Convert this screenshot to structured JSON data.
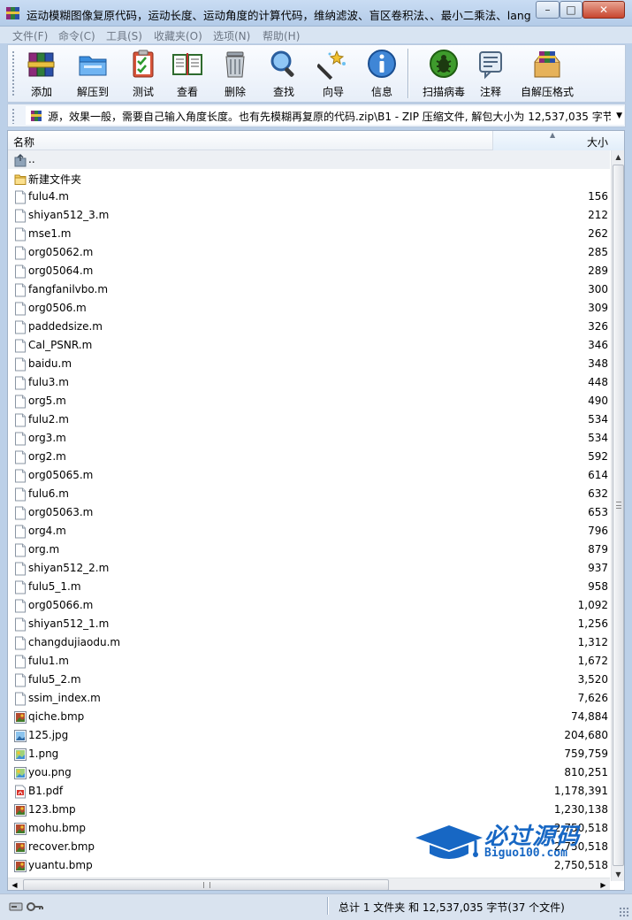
{
  "window": {
    "title": "运动模糊图像复原代码，运动长度、运动角度的计算代码，维纳滤波、盲区卷积法、、最小二乘法、lang...",
    "minimize": "–",
    "maximize": "□",
    "close": "✕"
  },
  "menu": [
    "文件(F)",
    "命令(C)",
    "工具(S)",
    "收藏夹(O)",
    "选项(N)",
    "帮助(H)"
  ],
  "toolbar": {
    "add": "添加",
    "extract": "解压到",
    "test": "测试",
    "view": "查看",
    "delete": "删除",
    "find": "查找",
    "wizard": "向导",
    "info": "信息",
    "virus_scan": "扫描病毒",
    "comment": "注释",
    "sfx": "自解压格式"
  },
  "address": {
    "path": "源，效果一般，需要自己输入角度长度。也有先模糊再复原的代码.zip\\B1 - ZIP 压缩文件, 解包大小为 12,537,035 字节"
  },
  "columns": {
    "name": "名称",
    "size": "大小"
  },
  "files": [
    {
      "name": "..",
      "size": "",
      "type": "parent"
    },
    {
      "name": "新建文件夹",
      "size": "",
      "type": "folder"
    },
    {
      "name": "fulu4.m",
      "size": "156",
      "type": "m"
    },
    {
      "name": "shiyan512_3.m",
      "size": "212",
      "type": "m"
    },
    {
      "name": "mse1.m",
      "size": "262",
      "type": "m"
    },
    {
      "name": "org05062.m",
      "size": "285",
      "type": "m"
    },
    {
      "name": "org05064.m",
      "size": "289",
      "type": "m"
    },
    {
      "name": "fangfanilvbo.m",
      "size": "300",
      "type": "m"
    },
    {
      "name": "org0506.m",
      "size": "309",
      "type": "m"
    },
    {
      "name": "paddedsize.m",
      "size": "326",
      "type": "m"
    },
    {
      "name": "Cal_PSNR.m",
      "size": "346",
      "type": "m"
    },
    {
      "name": "baidu.m",
      "size": "348",
      "type": "m"
    },
    {
      "name": "fulu3.m",
      "size": "448",
      "type": "m"
    },
    {
      "name": "org5.m",
      "size": "490",
      "type": "m"
    },
    {
      "name": "fulu2.m",
      "size": "534",
      "type": "m"
    },
    {
      "name": "org3.m",
      "size": "534",
      "type": "m"
    },
    {
      "name": "org2.m",
      "size": "592",
      "type": "m"
    },
    {
      "name": "org05065.m",
      "size": "614",
      "type": "m"
    },
    {
      "name": "fulu6.m",
      "size": "632",
      "type": "m"
    },
    {
      "name": "org05063.m",
      "size": "653",
      "type": "m"
    },
    {
      "name": "org4.m",
      "size": "796",
      "type": "m"
    },
    {
      "name": "org.m",
      "size": "879",
      "type": "m"
    },
    {
      "name": "shiyan512_2.m",
      "size": "937",
      "type": "m"
    },
    {
      "name": "fulu5_1.m",
      "size": "958",
      "type": "m"
    },
    {
      "name": "org05066.m",
      "size": "1,092",
      "type": "m"
    },
    {
      "name": "shiyan512_1.m",
      "size": "1,256",
      "type": "m"
    },
    {
      "name": "changdujiaodu.m",
      "size": "1,312",
      "type": "m"
    },
    {
      "name": "fulu1.m",
      "size": "1,672",
      "type": "m"
    },
    {
      "name": "fulu5_2.m",
      "size": "3,520",
      "type": "m"
    },
    {
      "name": "ssim_index.m",
      "size": "7,626",
      "type": "m"
    },
    {
      "name": "qiche.bmp",
      "size": "74,884",
      "type": "bmp"
    },
    {
      "name": "125.jpg",
      "size": "204,680",
      "type": "jpg"
    },
    {
      "name": "1.png",
      "size": "759,759",
      "type": "png"
    },
    {
      "name": "you.png",
      "size": "810,251",
      "type": "png"
    },
    {
      "name": "B1.pdf",
      "size": "1,178,391",
      "type": "pdf"
    },
    {
      "name": "123.bmp",
      "size": "1,230,138",
      "type": "bmp"
    },
    {
      "name": "mohu.bmp",
      "size": "2,750,518",
      "type": "bmp"
    },
    {
      "name": "recover.bmp",
      "size": "2,750,518",
      "type": "bmp"
    },
    {
      "name": "yuantu.bmp",
      "size": "2,750,518",
      "type": "bmp"
    }
  ],
  "status": {
    "summary": "总计 1 文件夹 和 12,537,035 字节(37 个文件)"
  },
  "watermark": {
    "cn": "必过源码",
    "en": "Biguo100.com"
  },
  "colors": {
    "accent": "#1767c4",
    "title_bar": "#c9dcf3",
    "close_button": "#c8462f"
  }
}
